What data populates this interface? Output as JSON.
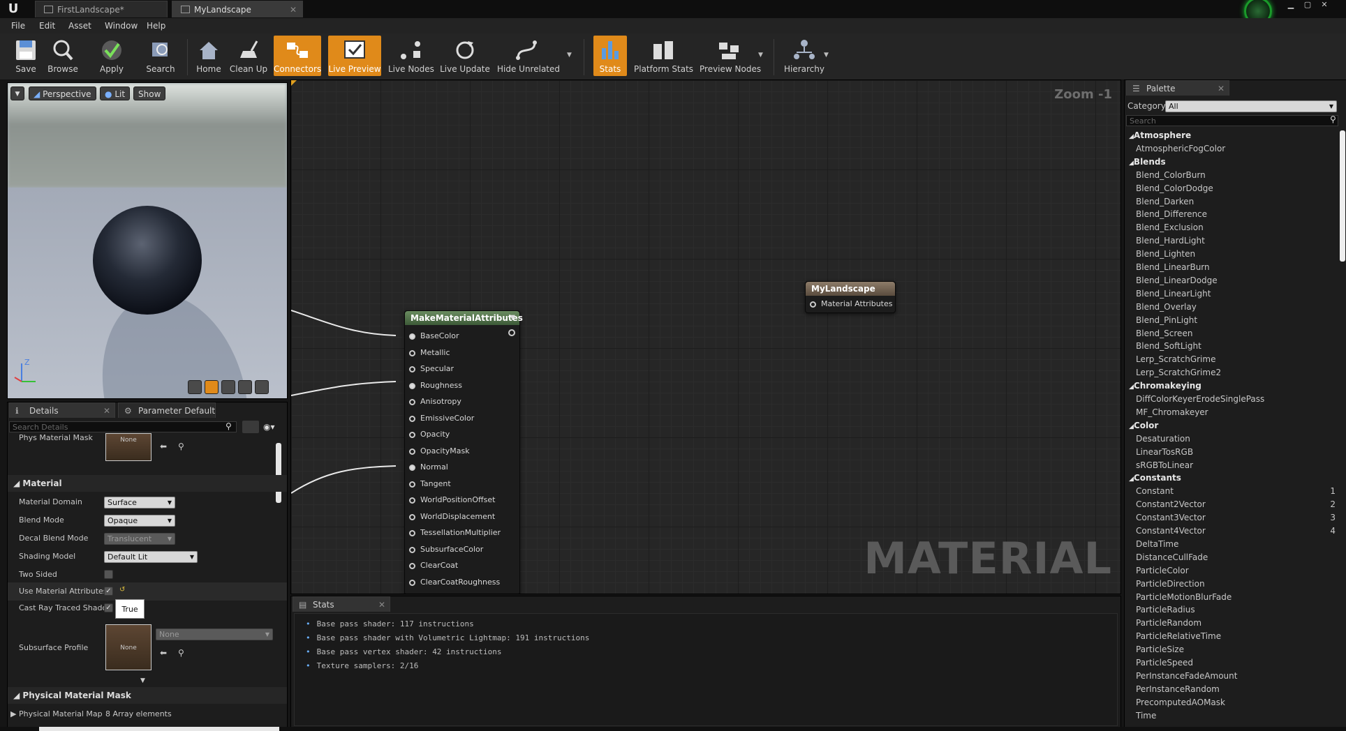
{
  "titlebar": {
    "tabs": [
      {
        "label": "FirstLandscape*",
        "active": false
      },
      {
        "label": "MyLandscape",
        "active": true
      }
    ],
    "close_glyph": "✕"
  },
  "menu": {
    "items": [
      "File",
      "Edit",
      "Asset",
      "Window",
      "Help"
    ]
  },
  "toolbar": {
    "tools": [
      {
        "label": "Save",
        "icon": "save-icon",
        "active": false
      },
      {
        "label": "Browse",
        "icon": "browse-icon",
        "active": false
      },
      {
        "label": "Apply",
        "icon": "apply-icon",
        "active": false
      },
      {
        "label": "Search",
        "icon": "search-icon",
        "active": false
      },
      {
        "label": "Home",
        "icon": "home-icon",
        "active": false
      },
      {
        "label": "Clean Up",
        "icon": "clean-up-icon",
        "active": false
      },
      {
        "label": "Connectors",
        "icon": "connectors-icon",
        "active": true
      },
      {
        "label": "Live Preview",
        "icon": "live-preview-icon",
        "active": true
      },
      {
        "label": "Live Nodes",
        "icon": "live-nodes-icon",
        "active": false
      },
      {
        "label": "Live Update",
        "icon": "live-update-icon",
        "active": false
      },
      {
        "label": "Hide Unrelated",
        "icon": "hide-unrelated-icon",
        "active": false
      },
      {
        "label": "Stats",
        "icon": "stats-icon",
        "active": true
      },
      {
        "label": "Platform Stats",
        "icon": "platform-stats-icon",
        "active": false
      },
      {
        "label": "Preview Nodes",
        "icon": "preview-nodes-icon",
        "active": false
      },
      {
        "label": "Hierarchy",
        "icon": "hierarchy-icon",
        "active": false
      }
    ]
  },
  "viewport": {
    "perspective_label": "Perspective",
    "lit_label": "Lit",
    "show_label": "Show",
    "axis_z": "Z"
  },
  "details": {
    "tab_details": "Details",
    "tab_params": "Parameter Defaults",
    "search_placeholder": "Search Details",
    "phys_material_mask_label": "Phys Material Mask",
    "none_label": "None",
    "material_section": "Material",
    "rows": [
      {
        "name": "Material Domain",
        "value": "Surface"
      },
      {
        "name": "Blend Mode",
        "value": "Opaque"
      },
      {
        "name": "Decal Blend Mode",
        "value": "Translucent"
      },
      {
        "name": "Shading Model",
        "value": "Default Lit"
      },
      {
        "name": "Two Sided",
        "value": ""
      },
      {
        "name": "Use Material Attributes",
        "value": ""
      },
      {
        "name": "Cast Ray Traced Shado",
        "value": ""
      },
      {
        "name": "Subsurface Profile",
        "value": "None"
      }
    ],
    "tooltip_true": "True",
    "phys_mask_section": "Physical Material Mask",
    "phys_material_map_label": "Physical Material Map",
    "phys_material_map_value": "8 Array elements"
  },
  "graph": {
    "zoom": "Zoom -1",
    "watermark": "MATERIAL",
    "make_node": {
      "title": "MakeMaterialAttributes",
      "pins": [
        "BaseColor",
        "Metallic",
        "Specular",
        "Roughness",
        "Anisotropy",
        "EmissiveColor",
        "Opacity",
        "OpacityMask",
        "Normal",
        "Tangent",
        "WorldPositionOffset",
        "WorldDisplacement",
        "TessellationMultiplier",
        "SubsurfaceColor",
        "ClearCoat",
        "ClearCoatRoughness"
      ],
      "connected": [
        0,
        3,
        8
      ]
    },
    "result_node": {
      "title": "MyLandscape",
      "pin": "Material Attributes"
    }
  },
  "stats": {
    "tab": "Stats",
    "lines": [
      "Base pass shader: 117 instructions",
      "Base pass shader with Volumetric Lightmap: 191 instructions",
      "Base pass vertex shader: 42 instructions",
      "Texture samplers: 2/16"
    ]
  },
  "palette": {
    "tab": "Palette",
    "category_label": "Category:",
    "category_value": "All",
    "search_placeholder": "Search",
    "entries": [
      {
        "type": "cat",
        "text": "Atmosphere"
      },
      {
        "type": "item",
        "text": "AtmosphericFogColor"
      },
      {
        "type": "cat",
        "text": "Blends"
      },
      {
        "type": "item",
        "text": "Blend_ColorBurn"
      },
      {
        "type": "item",
        "text": "Blend_ColorDodge"
      },
      {
        "type": "item",
        "text": "Blend_Darken"
      },
      {
        "type": "item",
        "text": "Blend_Difference"
      },
      {
        "type": "item",
        "text": "Blend_Exclusion"
      },
      {
        "type": "item",
        "text": "Blend_HardLight"
      },
      {
        "type": "item",
        "text": "Blend_Lighten"
      },
      {
        "type": "item",
        "text": "Blend_LinearBurn"
      },
      {
        "type": "item",
        "text": "Blend_LinearDodge"
      },
      {
        "type": "item",
        "text": "Blend_LinearLight"
      },
      {
        "type": "item",
        "text": "Blend_Overlay"
      },
      {
        "type": "item",
        "text": "Blend_PinLight"
      },
      {
        "type": "item",
        "text": "Blend_Screen"
      },
      {
        "type": "item",
        "text": "Blend_SoftLight"
      },
      {
        "type": "item",
        "text": "Lerp_ScratchGrime"
      },
      {
        "type": "item",
        "text": "Lerp_ScratchGrime2"
      },
      {
        "type": "cat",
        "text": "Chromakeying"
      },
      {
        "type": "item",
        "text": "DiffColorKeyerErodeSinglePass"
      },
      {
        "type": "item",
        "text": "MF_Chromakeyer"
      },
      {
        "type": "cat",
        "text": "Color"
      },
      {
        "type": "item",
        "text": "Desaturation"
      },
      {
        "type": "item",
        "text": "LinearTosRGB"
      },
      {
        "type": "item",
        "text": "sRGBToLinear"
      },
      {
        "type": "cat",
        "text": "Constants"
      },
      {
        "type": "item",
        "text": "Constant",
        "key": "1"
      },
      {
        "type": "item",
        "text": "Constant2Vector",
        "key": "2"
      },
      {
        "type": "item",
        "text": "Constant3Vector",
        "key": "3"
      },
      {
        "type": "item",
        "text": "Constant4Vector",
        "key": "4"
      },
      {
        "type": "item",
        "text": "DeltaTime"
      },
      {
        "type": "item",
        "text": "DistanceCullFade"
      },
      {
        "type": "item",
        "text": "ParticleColor"
      },
      {
        "type": "item",
        "text": "ParticleDirection"
      },
      {
        "type": "item",
        "text": "ParticleMotionBlurFade"
      },
      {
        "type": "item",
        "text": "ParticleRadius"
      },
      {
        "type": "item",
        "text": "ParticleRandom"
      },
      {
        "type": "item",
        "text": "ParticleRelativeTime"
      },
      {
        "type": "item",
        "text": "ParticleSize"
      },
      {
        "type": "item",
        "text": "ParticleSpeed"
      },
      {
        "type": "item",
        "text": "PerInstanceFadeAmount"
      },
      {
        "type": "item",
        "text": "PerInstanceRandom"
      },
      {
        "type": "item",
        "text": "PrecomputedAOMask"
      },
      {
        "type": "item",
        "text": "Time"
      }
    ]
  },
  "colors": {
    "accent_orange": "#e08a1a",
    "node_header_green": "#4d6e47",
    "result_header": "#7a6a58"
  }
}
